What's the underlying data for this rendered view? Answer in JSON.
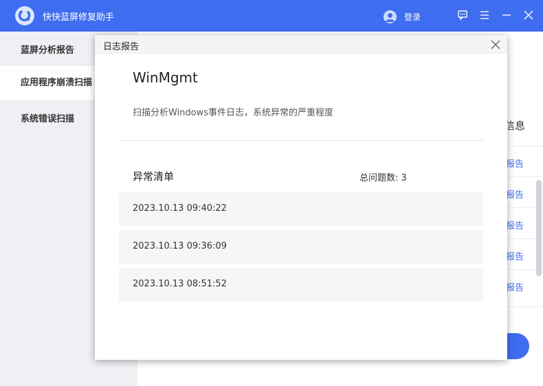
{
  "app": {
    "title": "快快蓝屏修复助手",
    "login_label": "登录",
    "accent_color": "#3f6df0",
    "titlebar_icons": [
      "feedback-icon",
      "menu-icon",
      "minimize-icon",
      "close-icon"
    ]
  },
  "sidebar": {
    "items": [
      {
        "label": "蓝屏分析报告"
      },
      {
        "label": "应用程序崩溃扫描"
      },
      {
        "label": "系统错误扫描"
      }
    ]
  },
  "background": {
    "info_title": "信息",
    "report_link": "报告"
  },
  "modal": {
    "title": "日志报告",
    "app_name": "WinMgmt",
    "description": "扫描分析Windows事件日志，系统异常的严重程度",
    "list_title": "异常清单",
    "total_label": "总问题数: 3",
    "rows": [
      {
        "time": "2023.10.13 09:40:22"
      },
      {
        "time": "2023.10.13 09:36:09"
      },
      {
        "time": "2023.10.13 08:51:52"
      }
    ]
  }
}
